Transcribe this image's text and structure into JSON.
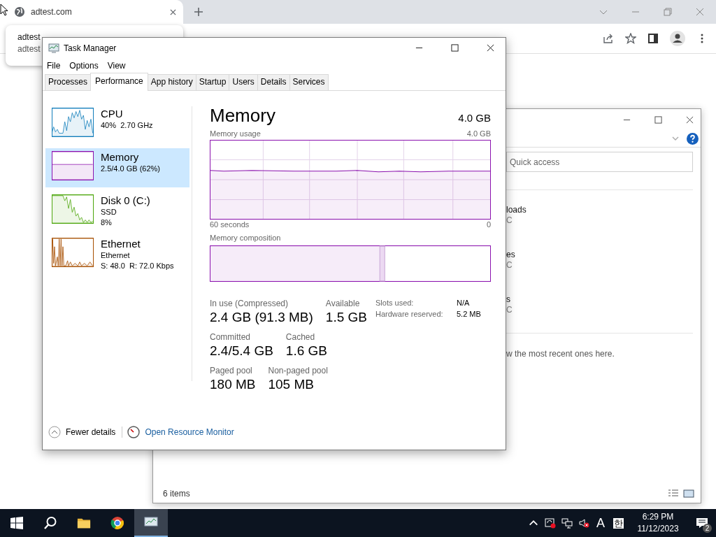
{
  "browser": {
    "tab_title": "adtest.com",
    "popup": [
      "adtest",
      "adtest"
    ]
  },
  "explorer": {
    "search_placeholder": "Quick access",
    "items": [
      {
        "name": "loads",
        "sub": "C"
      },
      {
        "name": "es",
        "sub": "C"
      },
      {
        "name": "s",
        "sub": "C"
      }
    ],
    "recent_note": "w the most recent ones here.",
    "status": "6 items"
  },
  "task_manager": {
    "title": "Task Manager",
    "menu": [
      "File",
      "Options",
      "View"
    ],
    "tabs": [
      {
        "label": "Processes",
        "selected": false
      },
      {
        "label": "Performance",
        "selected": true
      },
      {
        "label": "App history",
        "selected": false
      },
      {
        "label": "Startup",
        "selected": false
      },
      {
        "label": "Users",
        "selected": false
      },
      {
        "label": "Details",
        "selected": false
      },
      {
        "label": "Services",
        "selected": false
      }
    ],
    "resources": [
      {
        "name": "CPU",
        "lines": [
          "40%  2.70 GHz"
        ],
        "color": "#117dbb",
        "selected": false
      },
      {
        "name": "Memory",
        "lines": [
          "2.5/4.0 GB (62%)"
        ],
        "color": "#8b12ae",
        "selected": true
      },
      {
        "name": "Disk 0 (C:)",
        "lines": [
          "SSD",
          "8%"
        ],
        "color": "#4da60c",
        "selected": false
      },
      {
        "name": "Ethernet",
        "lines": [
          "Ethernet",
          "S: 48.0  R: 72.0 Kbps"
        ],
        "color": "#a74f01",
        "selected": false
      }
    ],
    "detail": {
      "title": "Memory",
      "total": "4.0 GB",
      "usage_label": "Memory usage",
      "usage_max": "4.0 GB",
      "time_label": "60 seconds",
      "time_end": "0",
      "composition_label": "Memory composition",
      "stat_rows": [
        [
          {
            "label": "In use (Compressed)",
            "value": "2.4 GB (91.3 MB)"
          },
          {
            "label": "Available",
            "value": "1.5 GB"
          }
        ],
        [
          {
            "label": "Committed",
            "value": "2.4/5.4 GB"
          },
          {
            "label": "Cached",
            "value": "1.6 GB"
          }
        ],
        [
          {
            "label": "Paged pool",
            "value": "180 MB"
          },
          {
            "label": "Non-paged pool",
            "value": "105 MB"
          }
        ]
      ],
      "side_stats": [
        {
          "label": "Slots used:",
          "value": "N/A"
        },
        {
          "label": "Hardware reserved:",
          "value": "5.2 MB"
        }
      ]
    },
    "footer": {
      "fewer": "Fewer details",
      "monitor": "Open Resource Monitor"
    }
  },
  "taskbar": {
    "ime": "A",
    "korean": "한",
    "time": "6:29 PM",
    "date": "11/12/2023",
    "notifications": "2"
  }
}
